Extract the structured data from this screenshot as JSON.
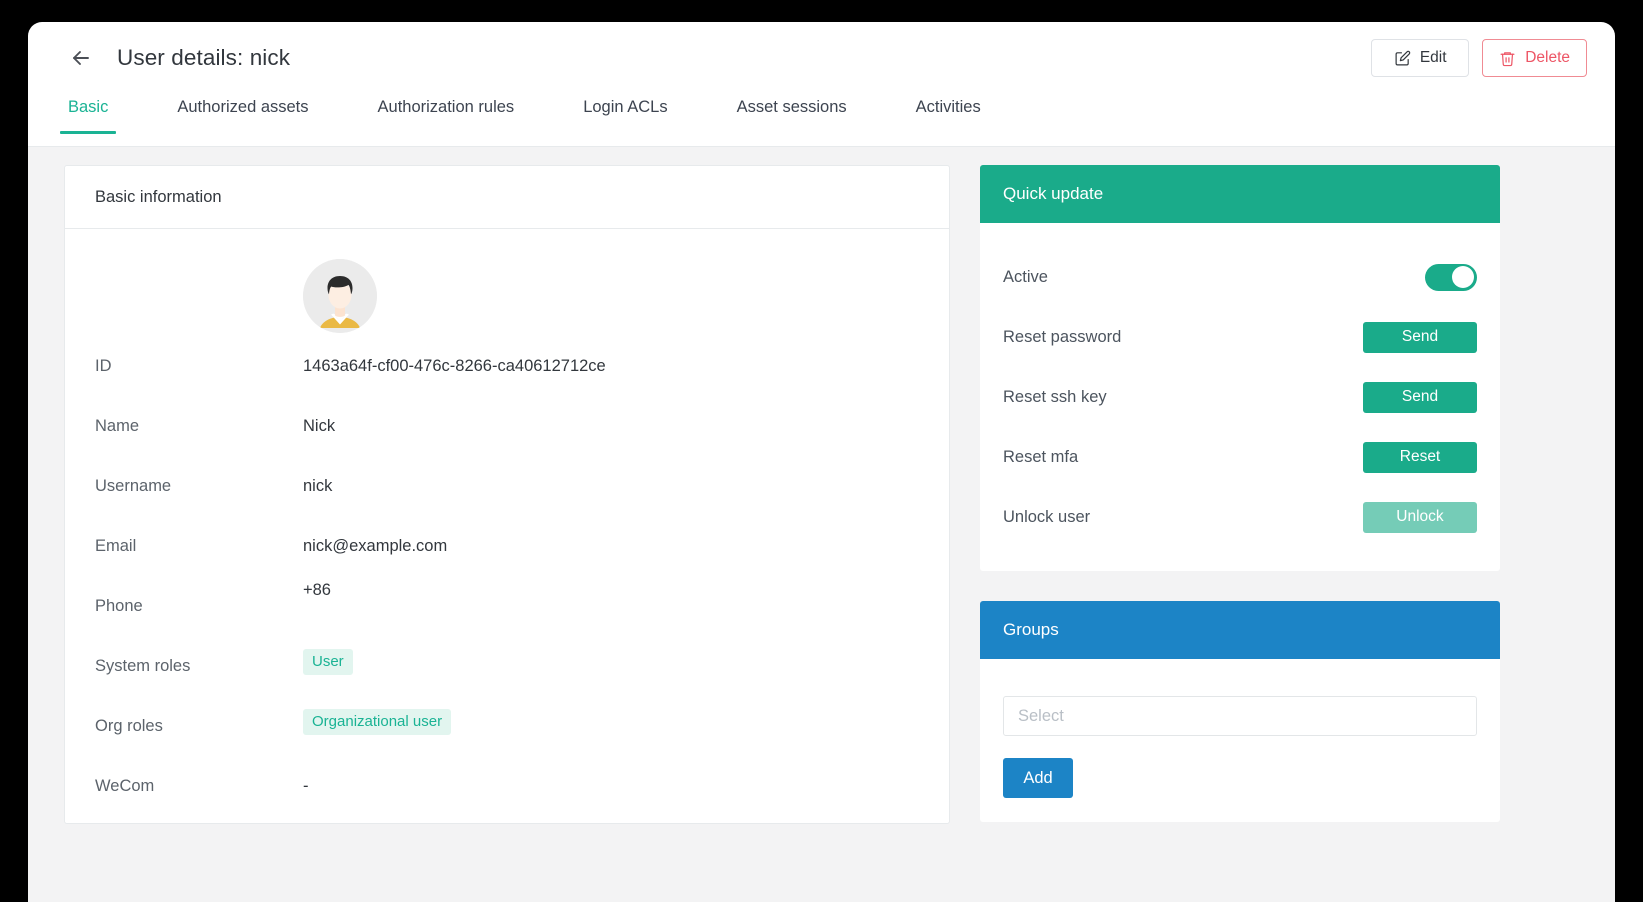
{
  "header": {
    "back_icon": "arrow-left-icon",
    "title": "User details: nick",
    "edit_label": "Edit",
    "edit_icon": "edit-square-icon",
    "delete_label": "Delete",
    "delete_icon": "trash-icon"
  },
  "tabs": [
    {
      "label": "Basic",
      "active": true
    },
    {
      "label": "Authorized assets",
      "active": false
    },
    {
      "label": "Authorization rules",
      "active": false
    },
    {
      "label": "Login ACLs",
      "active": false
    },
    {
      "label": "Asset sessions",
      "active": false
    },
    {
      "label": "Activities",
      "active": false
    }
  ],
  "basic_information": {
    "title": "Basic information",
    "avatar_icon": "user-avatar",
    "fields": [
      {
        "label": "ID",
        "value": "1463a64f-cf00-476c-8266-ca40612712ce",
        "type": "text"
      },
      {
        "label": "Name",
        "value": "Nick",
        "type": "text"
      },
      {
        "label": "Username",
        "value": "nick",
        "type": "text"
      },
      {
        "label": "Email",
        "value": "nick@example.com",
        "type": "text"
      },
      {
        "label": "Phone",
        "value": "+86",
        "type": "text"
      },
      {
        "label": "System roles",
        "value": "User",
        "type": "tag"
      },
      {
        "label": "Org roles",
        "value": "Organizational user",
        "type": "tag"
      },
      {
        "label": "WeCom",
        "value": "-",
        "type": "text"
      }
    ]
  },
  "quick_update": {
    "title": "Quick update",
    "rows": [
      {
        "label": "Active",
        "control": "toggle",
        "state": "on"
      },
      {
        "label": "Reset password",
        "control": "button",
        "button_label": "Send",
        "disabled": false
      },
      {
        "label": "Reset ssh key",
        "control": "button",
        "button_label": "Send",
        "disabled": false
      },
      {
        "label": "Reset mfa",
        "control": "button",
        "button_label": "Reset",
        "disabled": false
      },
      {
        "label": "Unlock user",
        "control": "button",
        "button_label": "Unlock",
        "disabled": true
      }
    ]
  },
  "groups": {
    "title": "Groups",
    "select_placeholder": "Select",
    "add_label": "Add"
  },
  "colors": {
    "accent_green": "#1ab394",
    "panel_green": "#1aab8a",
    "panel_blue": "#1c84c6",
    "danger_red": "#ed5565",
    "page_bg": "#f3f3f4"
  }
}
